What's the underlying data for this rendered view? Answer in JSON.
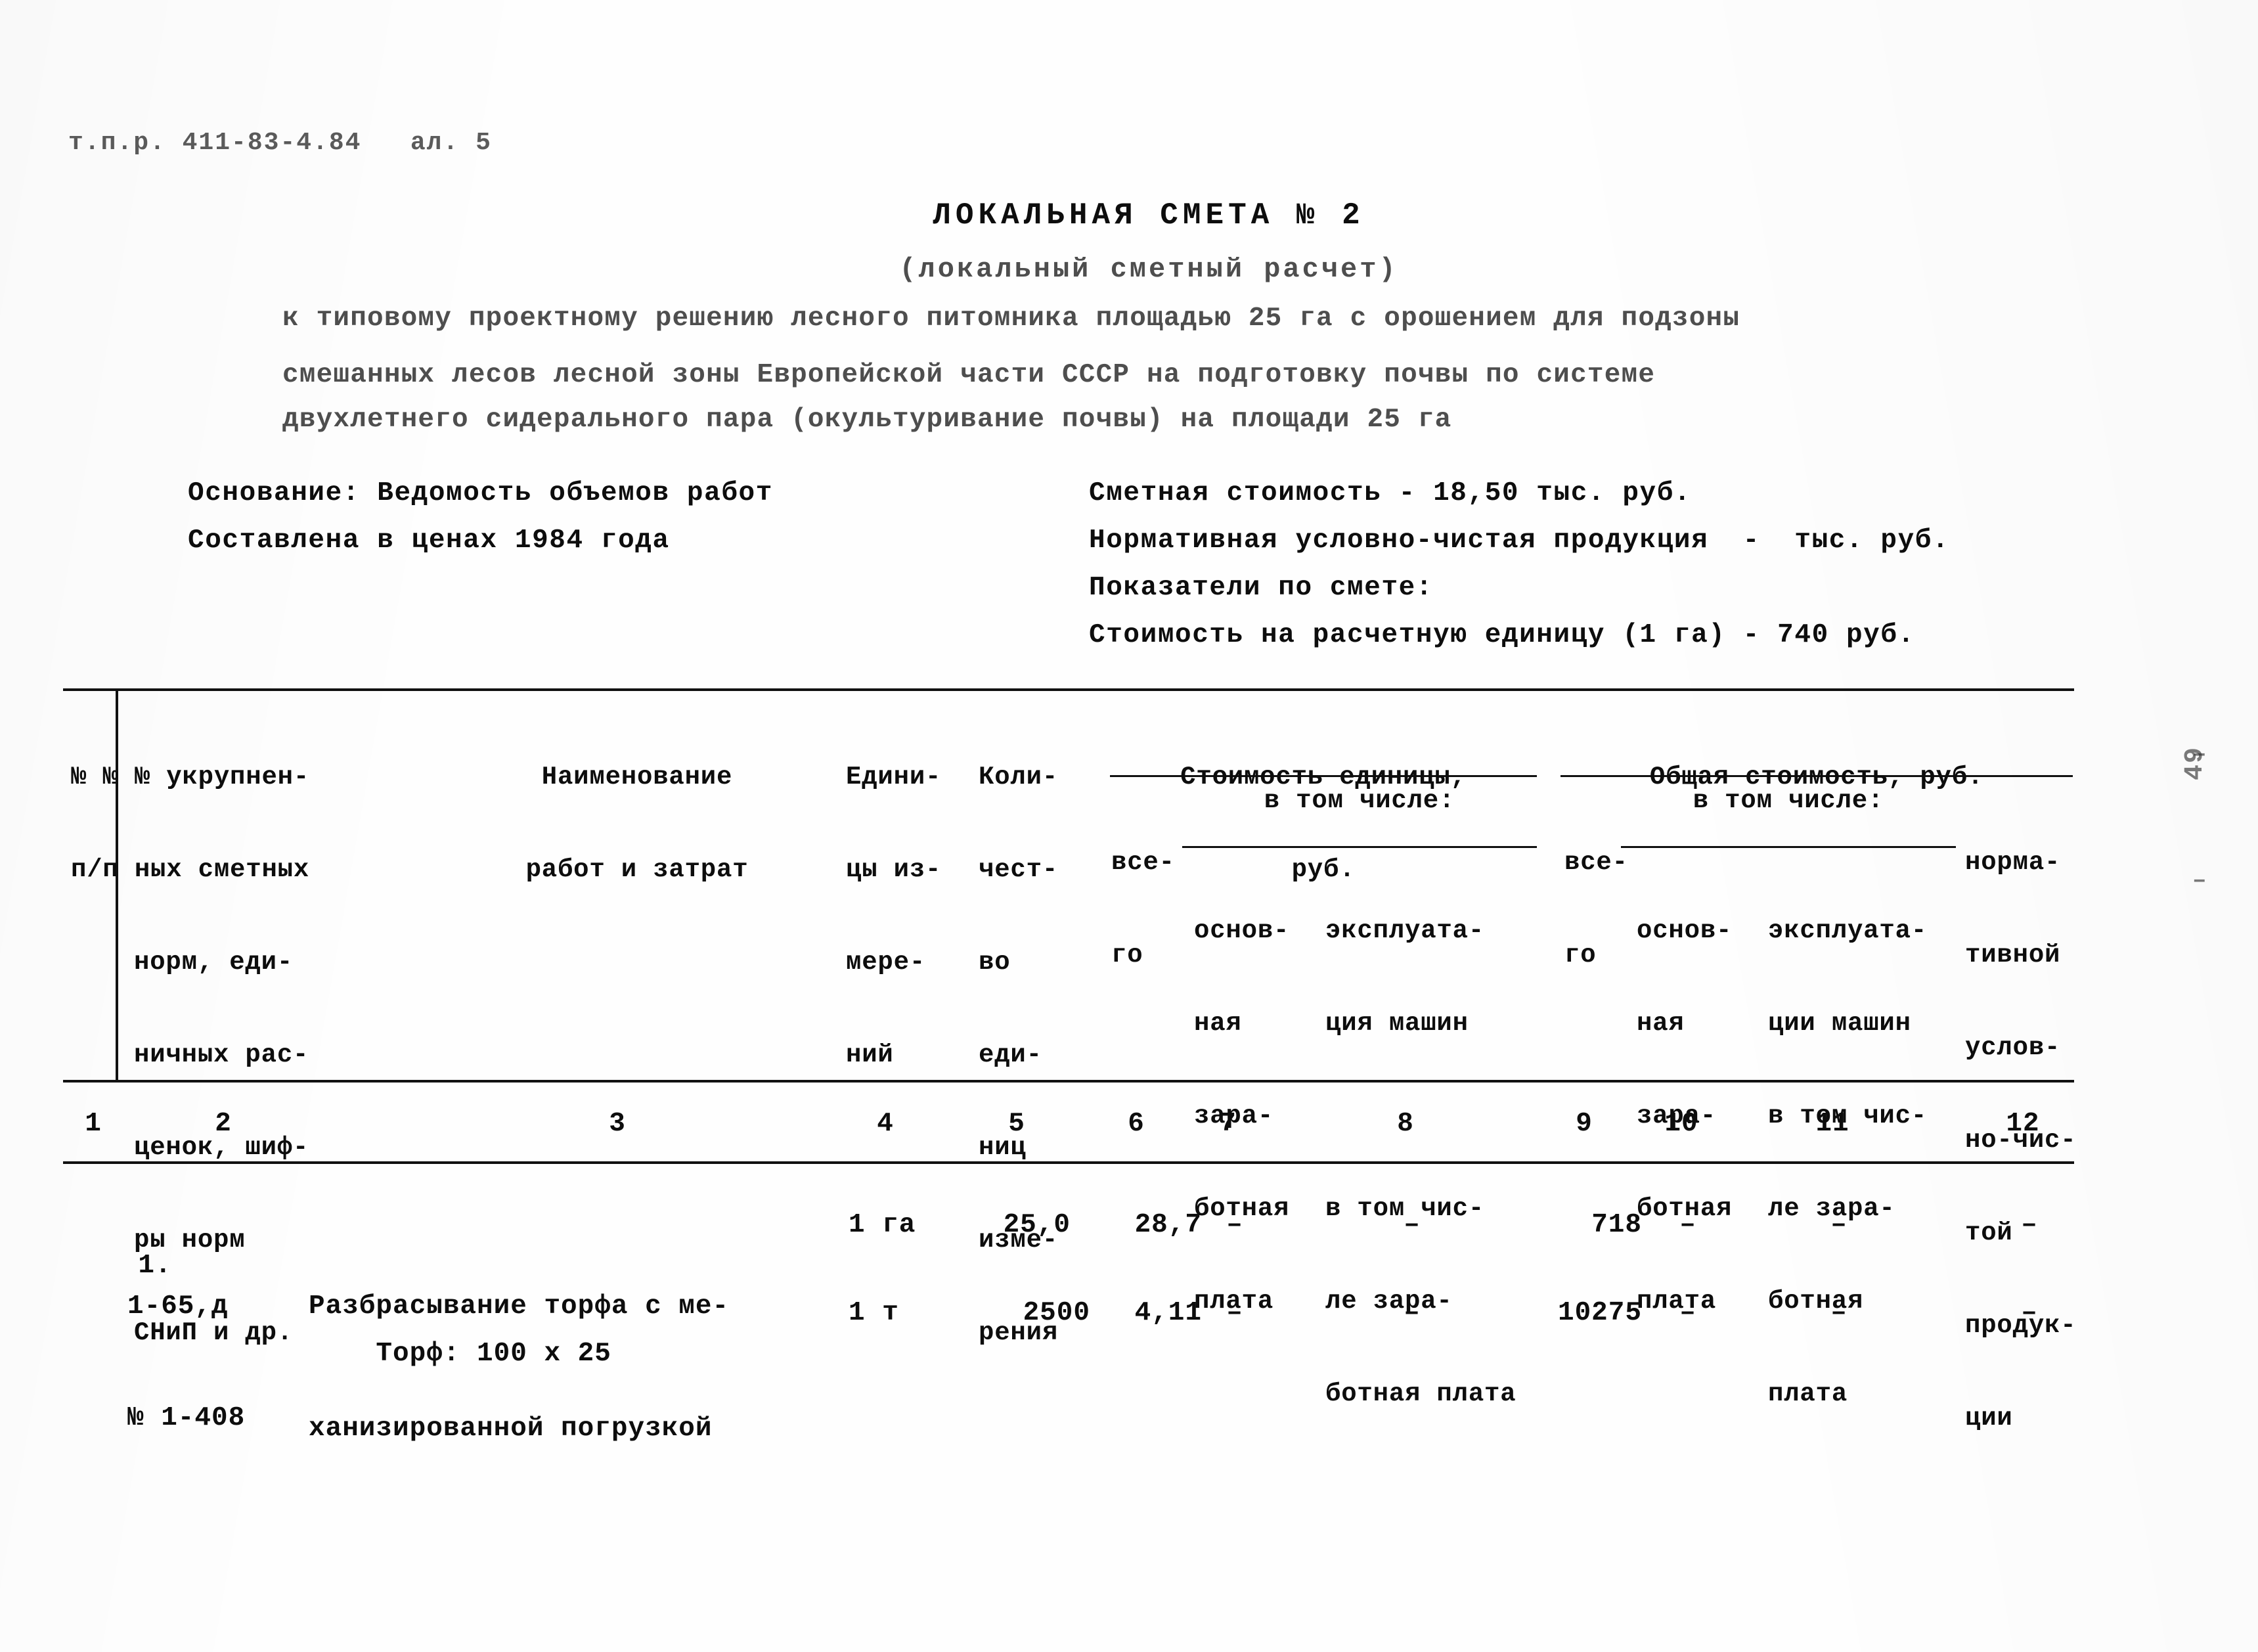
{
  "document": {
    "code_line": "т.п.р. 411-83-4.84   ал. 5",
    "title": "ЛОКАЛЬНАЯ СМЕТА № 2",
    "subtitle": "(локальный сметный расчет)",
    "description": [
      "к типовому проектному решению лесного питомника площадью 25 га с орошением для подзоны",
      "смешанных лесов лесной зоны Европейской части СССР на подготовку почвы по системе",
      "двухлетнего сидерального пара (окультуривание почвы) на площади 25 га"
    ],
    "page_number": "49"
  },
  "meta": {
    "left": [
      "Основание: Ведомость объемов работ",
      "Составлена в ценах 1984 года"
    ],
    "right": [
      "Сметная стоимость - 18,50 тыс. руб.",
      "Нормативная условно-чистая продукция  -  тыс. руб.",
      "Показатели по смете:",
      "Стоимость на расчетную единицу (1 га) - 740 руб."
    ]
  },
  "table": {
    "headers": {
      "col1": "№ № № укрупненных сметных норм, единичных расценок, шифры норм СНиП и др.",
      "col1_lines": [
        "№ № № укрупнен-",
        "п/п ных сметных",
        "норм, еди-",
        "ничных рас-",
        "ценок, шиф-",
        "ры норм",
        "СНиП и др."
      ],
      "col2_lines": [
        "Наименование",
        "работ и затрат"
      ],
      "col3_lines": [
        "Едини-",
        "цы из-",
        "мере-",
        "ний"
      ],
      "col4_lines": [
        "Коли-",
        "чест-",
        "во",
        "еди-",
        "ниц",
        "изме-",
        "рения"
      ],
      "group_unit_cost": "Стоимость единицы,",
      "group_unit_cost_2": "руб.",
      "group_total_cost": "Общая стоимость, руб.",
      "unit_vsego": [
        "все-",
        "го"
      ],
      "unit_in_which": "в том числе:",
      "unit_basic": [
        "основ-",
        "ная",
        "зара-",
        "ботная",
        "плата"
      ],
      "unit_machines": [
        "эксплуата-",
        "ция машин",
        "",
        "в том чис-",
        "ле зара-",
        "ботная плата"
      ],
      "total_vsego": [
        "все-",
        "го"
      ],
      "total_in_which": "в том числе:",
      "total_basic": [
        "основ-",
        "ная",
        "зара-",
        "ботная",
        "плата"
      ],
      "total_machines": [
        "эксплуата-",
        "ции машин",
        "",
        "в том чис-",
        "ле зара-",
        "ботная",
        "плата"
      ],
      "total_nchp": [
        "норма-",
        "тивной",
        "услов-",
        "но-чис-",
        "той",
        "продук-",
        "ции"
      ]
    },
    "column_numbers": [
      "1",
      "2",
      "3",
      "4",
      "5",
      "6",
      "7",
      "8",
      "9",
      "10",
      "11",
      "12"
    ],
    "rows": [
      {
        "num": "1.",
        "norm_code_line1": "1-65,д",
        "norm_code_line2": "№ 1-408",
        "name_line1": "Разбрасывание торфа с ме-",
        "name_line2": "ханизированной погрузкой",
        "unit": "1 га",
        "qty": "25,0",
        "unit_total": "28,7",
        "unit_basic": "–",
        "unit_machines": "–",
        "total_total": "718",
        "total_basic": "–",
        "total_machines": "–",
        "total_nchp": "–"
      },
      {
        "num": "",
        "norm_code_line1": "",
        "norm_code_line2": "",
        "name_line1": "Торф: 100 x 25",
        "name_line2": "",
        "unit": "1 т",
        "qty": "2500",
        "unit_total": "4,11",
        "unit_basic": "–",
        "unit_machines": "–",
        "total_total": "10275",
        "total_basic": "–",
        "total_machines": "–",
        "total_nchp": "–"
      }
    ]
  }
}
